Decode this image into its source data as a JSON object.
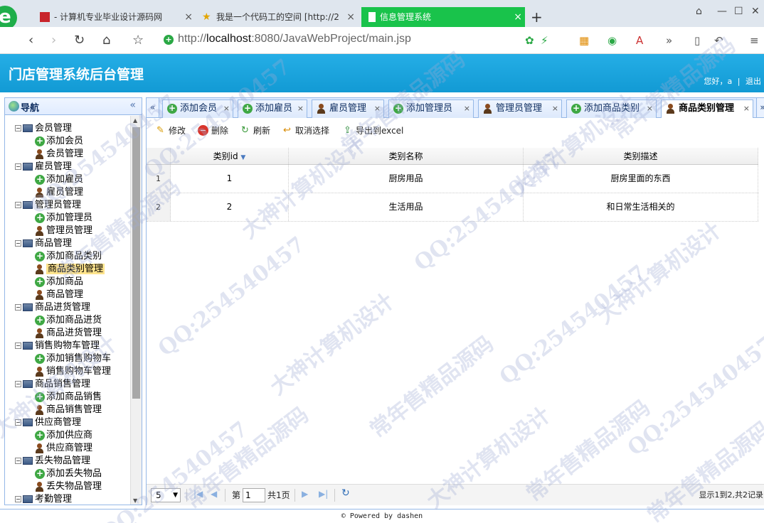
{
  "browser": {
    "tabs": [
      {
        "label": "- 计算机专业毕业设计源码网",
        "icon": "red-square-icon"
      },
      {
        "label": "我是一个代码工的空间 [http://2",
        "icon": "star-icon"
      },
      {
        "label": "信息管理系统",
        "icon": "document-icon",
        "active": true
      }
    ],
    "new_tab": "+",
    "url_prefix": "http://",
    "url_host": "localhost",
    "url_rest": ":8080/JavaWebProject/main.jsp"
  },
  "app": {
    "title": "门店管理系统后台管理",
    "greeting": "您好，a",
    "logout": "退出"
  },
  "sidebar": {
    "title": "导航",
    "collapse": "«",
    "groups": [
      {
        "label": "会员管理",
        "children": [
          {
            "label": "添加会员",
            "icon": "plus"
          },
          {
            "label": "会员管理",
            "icon": "person"
          }
        ]
      },
      {
        "label": "雇员管理",
        "children": [
          {
            "label": "添加雇员",
            "icon": "plus"
          },
          {
            "label": "雇员管理",
            "icon": "person"
          }
        ]
      },
      {
        "label": "管理员管理",
        "children": [
          {
            "label": "添加管理员",
            "icon": "plus"
          },
          {
            "label": "管理员管理",
            "icon": "person"
          }
        ]
      },
      {
        "label": "商品管理",
        "children": [
          {
            "label": "添加商品类别",
            "icon": "plus"
          },
          {
            "label": "商品类别管理",
            "icon": "person",
            "selected": true
          },
          {
            "label": "添加商品",
            "icon": "plus"
          },
          {
            "label": "商品管理",
            "icon": "person"
          }
        ]
      },
      {
        "label": "商品进货管理",
        "children": [
          {
            "label": "添加商品进货",
            "icon": "plus"
          },
          {
            "label": "商品进货管理",
            "icon": "person"
          }
        ]
      },
      {
        "label": "销售购物车管理",
        "children": [
          {
            "label": "添加销售购物车",
            "icon": "plus"
          },
          {
            "label": "销售购物车管理",
            "icon": "person"
          }
        ]
      },
      {
        "label": "商品销售管理",
        "children": [
          {
            "label": "添加商品销售",
            "icon": "plus"
          },
          {
            "label": "商品销售管理",
            "icon": "person"
          }
        ]
      },
      {
        "label": "供应商管理",
        "children": [
          {
            "label": "添加供应商",
            "icon": "plus"
          },
          {
            "label": "供应商管理",
            "icon": "person"
          }
        ]
      },
      {
        "label": "丢失物品管理",
        "children": [
          {
            "label": "添加丢失物品",
            "icon": "plus"
          },
          {
            "label": "丢失物品管理",
            "icon": "person"
          }
        ]
      },
      {
        "label": "考勤管理",
        "children": []
      }
    ]
  },
  "panel_tabs": [
    {
      "label": "添加会员",
      "icon": "plus"
    },
    {
      "label": "添加雇员",
      "icon": "plus"
    },
    {
      "label": "雇员管理",
      "icon": "person"
    },
    {
      "label": "添加管理员",
      "icon": "plus"
    },
    {
      "label": "管理员管理",
      "icon": "person"
    },
    {
      "label": "添加商品类别",
      "icon": "plus"
    },
    {
      "label": "商品类别管理",
      "icon": "person",
      "active": true
    }
  ],
  "toolbar": {
    "edit": "修改",
    "delete": "删除",
    "refresh": "刷新",
    "deselect": "取消选择",
    "export": "导出到excel"
  },
  "table": {
    "columns": [
      "类别id",
      "类别名称",
      "类别描述"
    ],
    "rows": [
      {
        "num": "1",
        "cells": [
          "1",
          "厨房用品",
          "厨房里面的东西"
        ]
      },
      {
        "num": "2",
        "cells": [
          "2",
          "生活用品",
          "和日常生活相关的"
        ]
      }
    ]
  },
  "pager": {
    "page_size": "5",
    "page_label": "第",
    "page_value": "1",
    "total_pages": "共1页",
    "summary": "显示1到2,共2记录"
  },
  "footer": "© Powered by dashen",
  "watermarks": [
    "QQ:254540457",
    "大神计算机设计",
    "常年售精品源码"
  ]
}
